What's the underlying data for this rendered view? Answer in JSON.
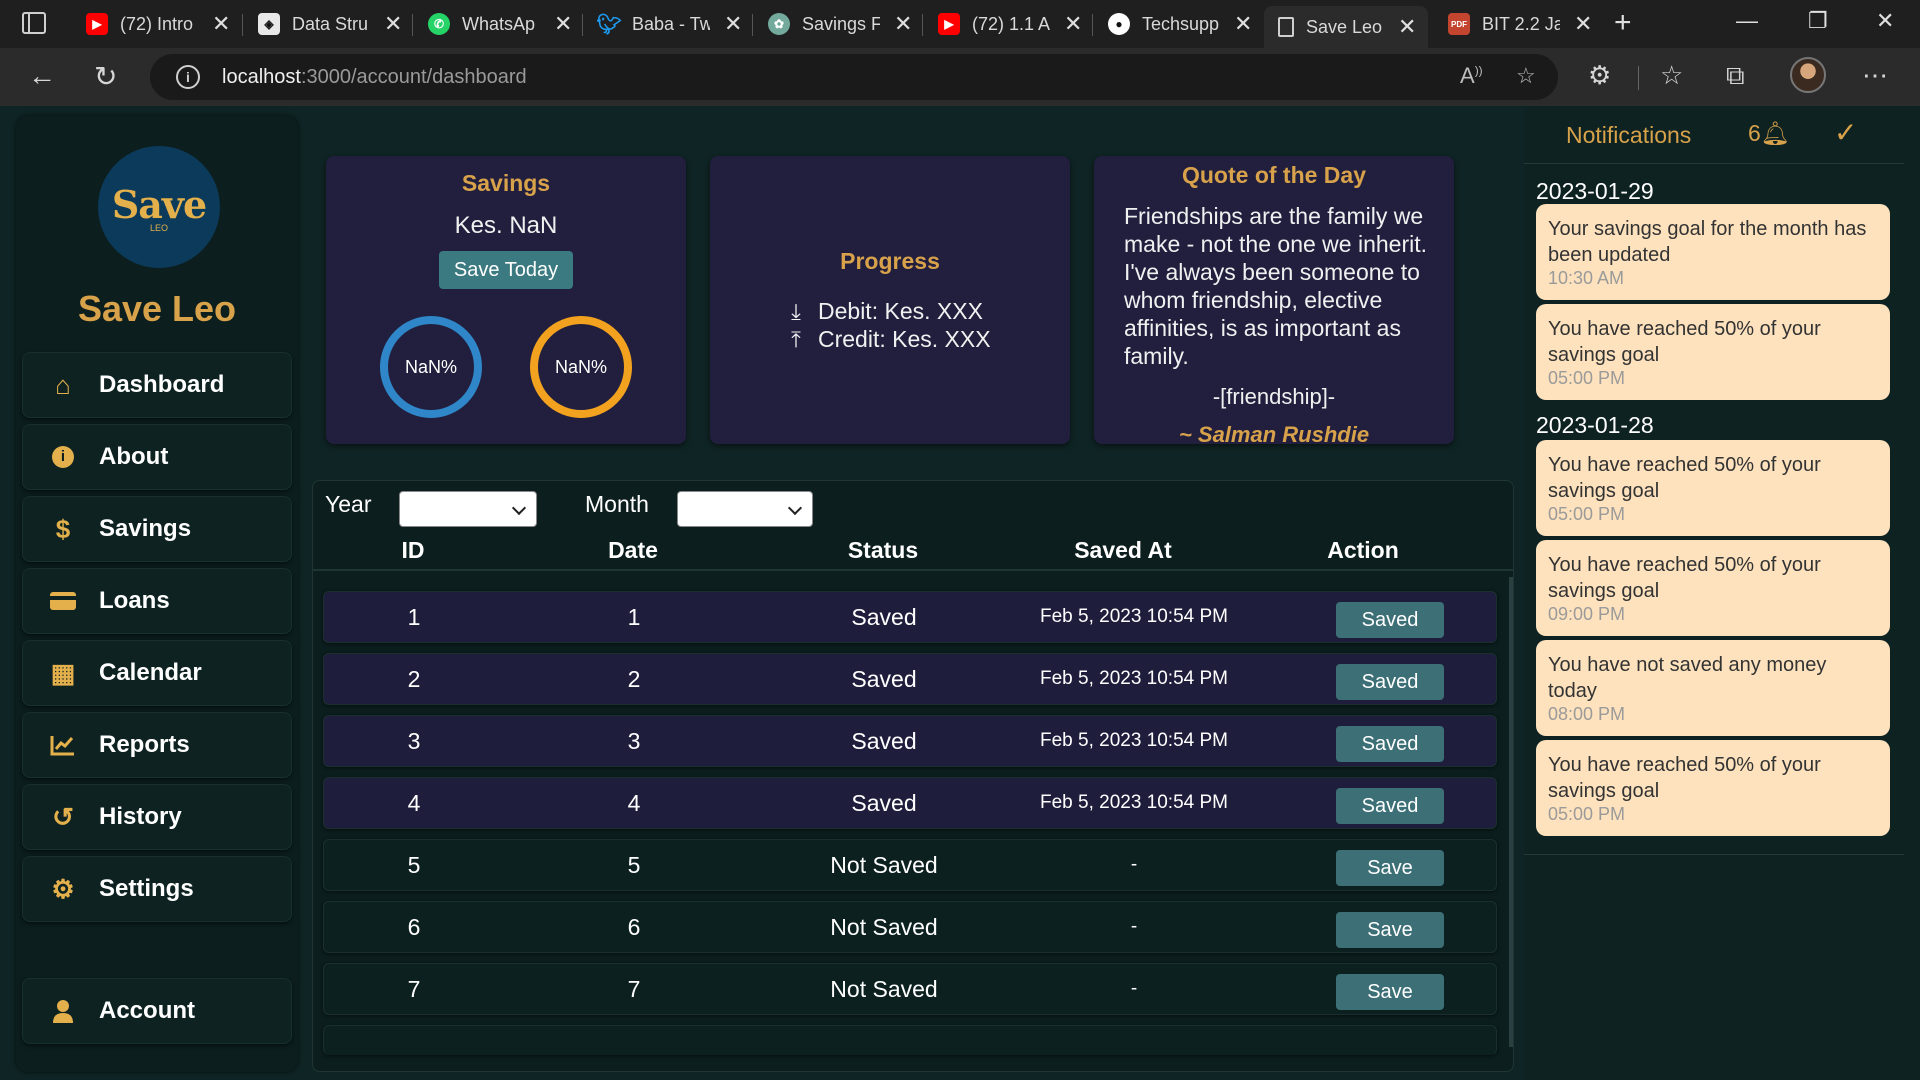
{
  "browser": {
    "tabs": [
      {
        "label": "(72) Intro",
        "icon": "youtube-icon",
        "color": "#ff0000"
      },
      {
        "label": "Data Stru",
        "icon": "page-icon",
        "color": "#e8e8e8"
      },
      {
        "label": "WhatsAp",
        "icon": "whatsapp-icon",
        "color": "#25d366"
      },
      {
        "label": "Baba - Tw",
        "icon": "twitter-icon",
        "color": "#1d9bf0"
      },
      {
        "label": "Savings F",
        "icon": "chatgpt-icon",
        "color": "#74aa9c"
      },
      {
        "label": "(72) 1.1 A",
        "icon": "youtube-icon",
        "color": "#ff0000"
      },
      {
        "label": "Techsupp",
        "icon": "github-icon",
        "color": "#ffffff"
      },
      {
        "label": "Save Leo",
        "icon": "document-icon",
        "color": "#cfcfcf"
      },
      {
        "label": "BIT 2.2 Ja",
        "icon": "pdf-icon",
        "color": "#c4452f"
      }
    ],
    "url_host": "localhost",
    "url_path": ":3000/account/dashboard"
  },
  "app": {
    "brand": "Save Leo",
    "logo_text": "Save",
    "logo_sub": "LEO",
    "nav": [
      {
        "label": "Dashboard",
        "icon": "home-icon"
      },
      {
        "label": "About",
        "icon": "info-icon"
      },
      {
        "label": "Savings",
        "icon": "dollar-icon"
      },
      {
        "label": "Loans",
        "icon": "credit-card-icon"
      },
      {
        "label": "Calendar",
        "icon": "calendar-icon"
      },
      {
        "label": "Reports",
        "icon": "chart-line-icon"
      },
      {
        "label": "History",
        "icon": "history-icon"
      },
      {
        "label": "Settings",
        "icon": "gear-icon"
      }
    ],
    "account_label": "Account"
  },
  "cards": {
    "savings": {
      "title": "Savings",
      "amount": "Kes. NaN",
      "button": "Save Today",
      "ring1": "NaN%",
      "ring2": "NaN%"
    },
    "progress": {
      "title": "Progress",
      "debit": "Debit: Kes. XXX",
      "credit": "Credit: Kes. XXX"
    },
    "quote": {
      "title": "Quote of the Day",
      "text": "Friendships are the family we make - not the one we inherit. I've always been someone to whom friendship, elective affinities, is as important as family.",
      "tag": "-[friendship]-",
      "author": "~ Salman Rushdie"
    }
  },
  "table": {
    "filters": {
      "year_label": "Year",
      "month_label": "Month"
    },
    "headers": [
      "ID",
      "Date",
      "Status",
      "Saved At",
      "Action"
    ],
    "rows": [
      {
        "id": "1",
        "date": "1",
        "status": "Saved",
        "saved_at": "Feb 5, 2023 10:54 PM",
        "action": "Saved"
      },
      {
        "id": "2",
        "date": "2",
        "status": "Saved",
        "saved_at": "Feb 5, 2023 10:54 PM",
        "action": "Saved"
      },
      {
        "id": "3",
        "date": "3",
        "status": "Saved",
        "saved_at": "Feb 5, 2023 10:54 PM",
        "action": "Saved"
      },
      {
        "id": "4",
        "date": "4",
        "status": "Saved",
        "saved_at": "Feb 5, 2023 10:54 PM",
        "action": "Saved"
      },
      {
        "id": "5",
        "date": "5",
        "status": "Not Saved",
        "saved_at": "-",
        "action": "Save"
      },
      {
        "id": "6",
        "date": "6",
        "status": "Not Saved",
        "saved_at": "-",
        "action": "Save"
      },
      {
        "id": "7",
        "date": "7",
        "status": "Not Saved",
        "saved_at": "-",
        "action": "Save"
      }
    ]
  },
  "notifications": {
    "title": "Notifications",
    "count": "6",
    "groups": [
      {
        "date": "2023-01-29",
        "items": [
          {
            "msg": "Your savings goal for the month has been updated",
            "time": "10:30 AM"
          },
          {
            "msg": "You have reached 50% of your savings goal",
            "time": "05:00 PM"
          }
        ]
      },
      {
        "date": "2023-01-28",
        "items": [
          {
            "msg": "You have reached 50% of your savings goal",
            "time": "05:00 PM"
          },
          {
            "msg": "You have reached 50% of your savings goal",
            "time": "09:00 PM"
          },
          {
            "msg": "You have not saved any money today",
            "time": "08:00 PM"
          },
          {
            "msg": "You have reached 50% of your savings goal",
            "time": "05:00 PM"
          }
        ]
      }
    ]
  }
}
